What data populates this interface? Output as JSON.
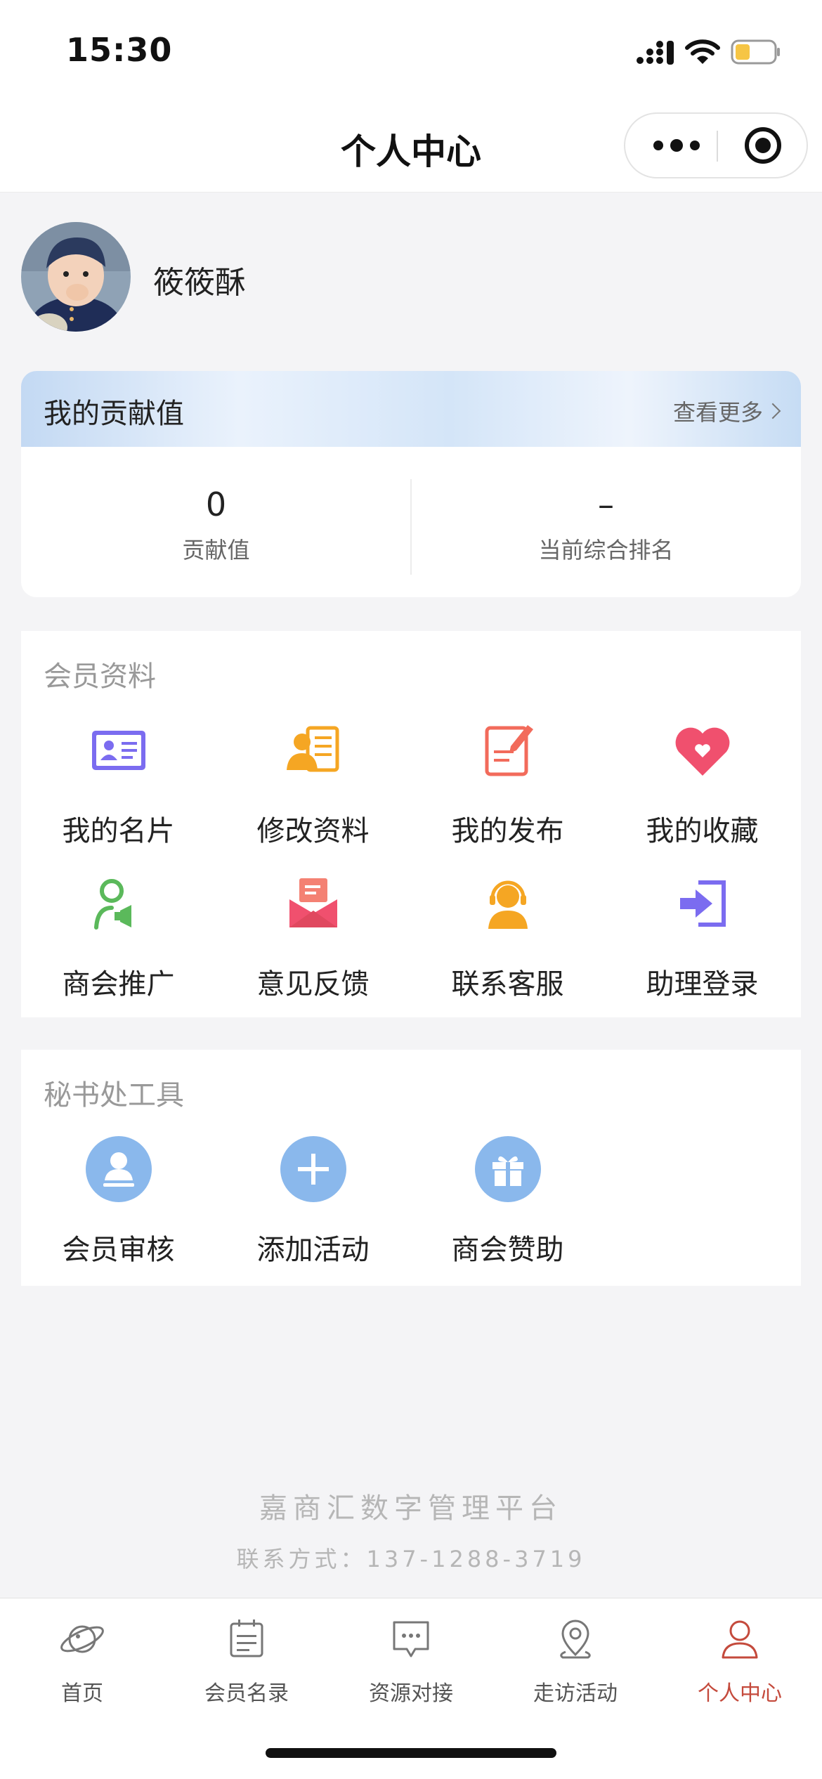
{
  "status_bar": {
    "time": "15:30"
  },
  "nav": {
    "title": "个人中心"
  },
  "profile": {
    "username": "筱筱酥"
  },
  "contribution": {
    "title": "我的贡献值",
    "more_label": "查看更多",
    "stats": [
      {
        "value": "0",
        "label": "贡献值"
      },
      {
        "value": "–",
        "label": "当前综合排名"
      }
    ]
  },
  "member_section": {
    "title": "会员资料",
    "items": [
      {
        "label": "我的名片",
        "icon": "business-card-icon"
      },
      {
        "label": "修改资料",
        "icon": "edit-profile-icon"
      },
      {
        "label": "我的发布",
        "icon": "publish-icon"
      },
      {
        "label": "我的收藏",
        "icon": "heart-icon"
      },
      {
        "label": "商会推广",
        "icon": "promotion-icon"
      },
      {
        "label": "意见反馈",
        "icon": "feedback-icon"
      },
      {
        "label": "联系客服",
        "icon": "customer-service-icon"
      },
      {
        "label": "助理登录",
        "icon": "login-icon"
      }
    ]
  },
  "secretary_section": {
    "title": "秘书处工具",
    "items": [
      {
        "label": "会员审核",
        "icon": "member-review-icon"
      },
      {
        "label": "添加活动",
        "icon": "plus-icon"
      },
      {
        "label": "商会赞助",
        "icon": "gift-icon"
      }
    ]
  },
  "footer": {
    "platform_name": "嘉商汇数字管理平台",
    "contact": "联系方式：137-1288-3719"
  },
  "tab_bar": {
    "tabs": [
      {
        "label": "首页",
        "icon": "planet-icon"
      },
      {
        "label": "会员名录",
        "icon": "calendar-list-icon"
      },
      {
        "label": "资源对接",
        "icon": "chat-icon"
      },
      {
        "label": "走访活动",
        "icon": "location-icon"
      },
      {
        "label": "个人中心",
        "icon": "person-icon",
        "active": true
      }
    ]
  },
  "colors": {
    "accent": "#c44a3c",
    "purple": "#7b6cf0",
    "orange": "#f5a623",
    "pink": "#f0506e",
    "green": "#5bb95b",
    "light_blue": "#8ab8ec"
  }
}
